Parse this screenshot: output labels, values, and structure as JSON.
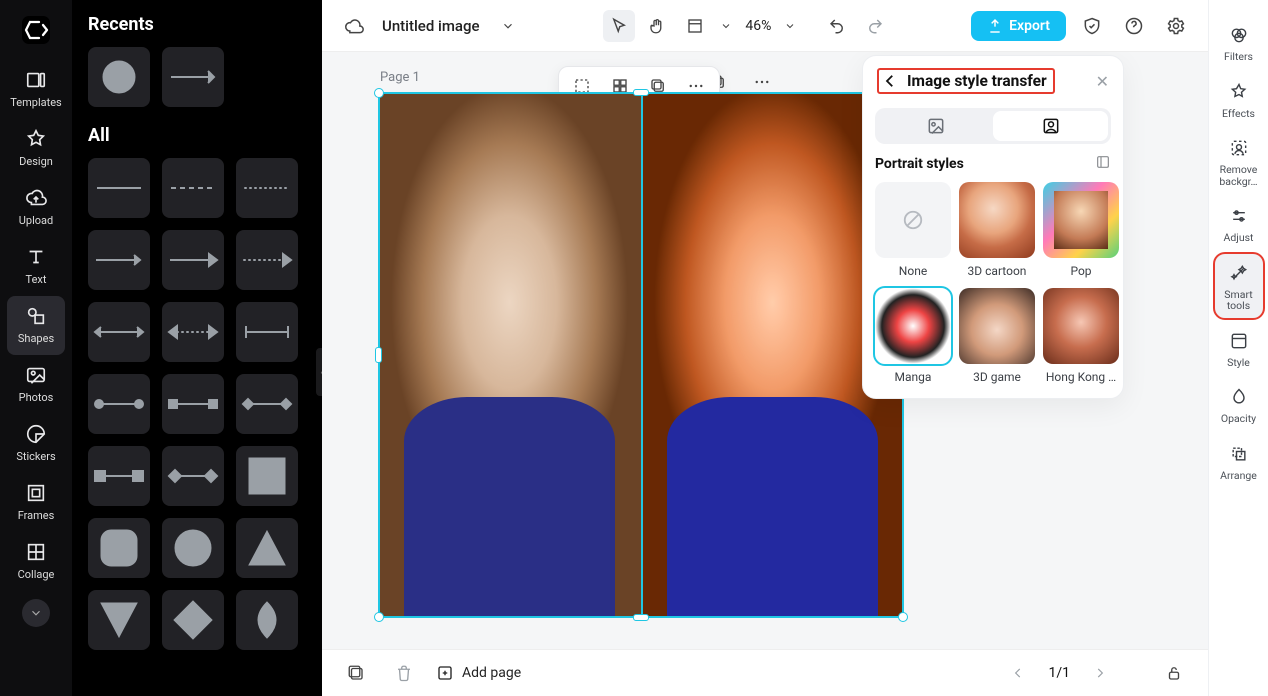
{
  "app": {
    "doc_title": "Untitled image"
  },
  "left_nav": {
    "items": [
      {
        "label": "Templates"
      },
      {
        "label": "Design"
      },
      {
        "label": "Upload"
      },
      {
        "label": "Text"
      },
      {
        "label": "Shapes"
      },
      {
        "label": "Photos"
      },
      {
        "label": "Stickers"
      },
      {
        "label": "Frames"
      },
      {
        "label": "Collage"
      }
    ]
  },
  "shapes_panel": {
    "section_recents": "Recents",
    "section_all": "All"
  },
  "topbar": {
    "zoom": "46%",
    "export": "Export"
  },
  "canvas": {
    "page_label": "Page 1"
  },
  "right_panel": {
    "title": "Image style transfer",
    "section_title": "Portrait styles",
    "styles": [
      {
        "label": "None"
      },
      {
        "label": "3D cartoon"
      },
      {
        "label": "Pop"
      },
      {
        "label": "Manga"
      },
      {
        "label": "3D game"
      },
      {
        "label": "Hong Kong …"
      }
    ]
  },
  "prop_bar": {
    "items": [
      {
        "label": "Filters"
      },
      {
        "label": "Effects"
      },
      {
        "label": "Remove backgr…"
      },
      {
        "label": "Adjust"
      },
      {
        "label": "Smart tools"
      },
      {
        "label": "Style"
      },
      {
        "label": "Opacity"
      },
      {
        "label": "Arrange"
      }
    ]
  },
  "bottom": {
    "add_page": "Add page",
    "pager": "1/1"
  }
}
